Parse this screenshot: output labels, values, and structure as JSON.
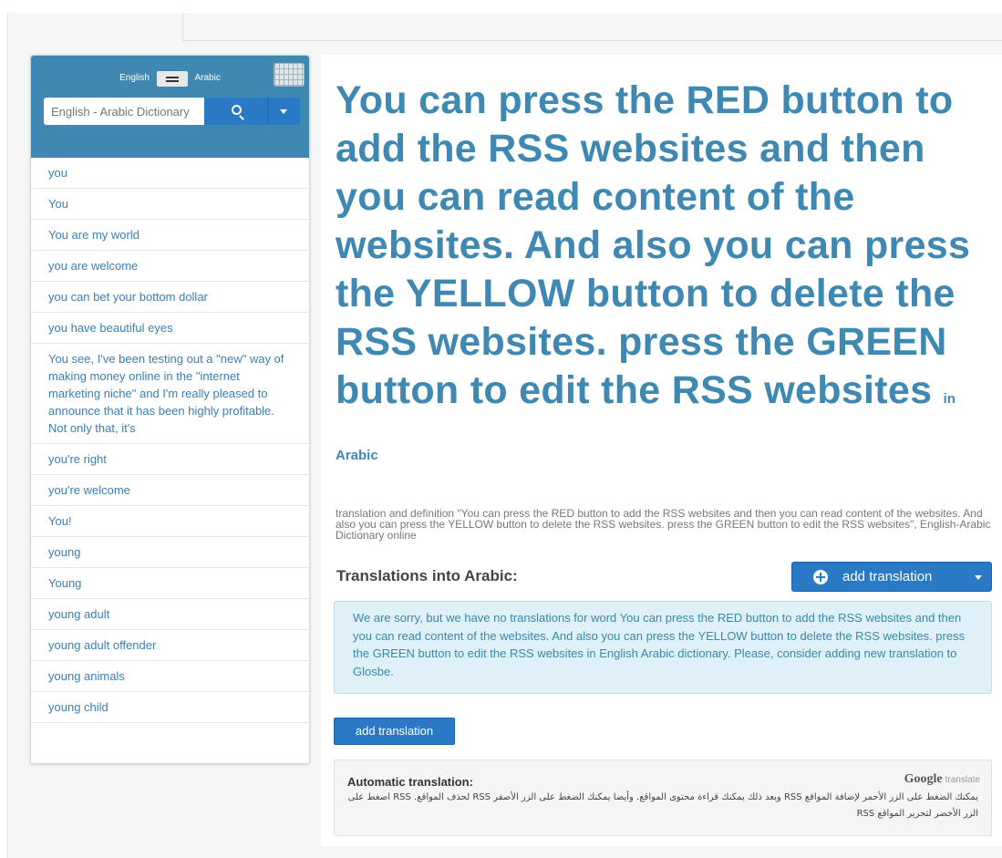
{
  "sidebar": {
    "lang_from": "English",
    "lang_to": "Arabic",
    "search_placeholder": "English - Arabic Dictionary",
    "suggestions": [
      "you",
      "You",
      "You are my world",
      "you are welcome",
      "you can bet your bottom dollar",
      "you have beautiful eyes",
      "You see, I've been testing out a \"new\" way of making money online in the \"internet marketing niche\" and I'm really pleased to announce that it has been highly profitable. Not only that, it's",
      "you're right",
      "you're welcome",
      "You!",
      "young",
      "Young",
      "young adult",
      "young adult offender",
      "young animals",
      "young child"
    ]
  },
  "main": {
    "headline": "You can press the RED button to add the RSS websites and then you can read content of the websites. And also you can press the YELLOW button to delete the RSS websites. press the GREEN button to edit the RSS websites",
    "headline_suffix": "in Arabic",
    "definition": "translation and definition \"You can press the RED button to add the RSS websites and then you can read content of the websites. And also you can press the YELLOW button to delete the RSS websites. press the GREEN button to edit the RSS websites\", English-Arabic Dictionary  online",
    "translations_heading": "Translations into Arabic:",
    "add_translation_dropdown_label": "add translation",
    "notice": "We are sorry, but we have no translations for word You can press the RED button to add the RSS websites and then you can read content of the websites. And also you can press the YELLOW button to delete the RSS websites. press the GREEN button to edit the RSS websites in English Arabic dictionary. Please, consider adding new translation to Glosbe.",
    "add_translation_button_label": "add translation",
    "automatic_title": "Automatic translation:",
    "google_brand": "Google",
    "google_translate": "translate",
    "automatic_text": "يمكنك الضغط على الزر الأحمر لإضافة المواقع RSS وبعد ذلك يمكنك قراءة محتوى المواقع. وأيضا يمكنك الضغط على الزر الأصفر RSS لحذف المواقع. RSS اضغط على الزر الأخضر لتحرير المواقع RSS"
  },
  "colors": {
    "brand_blue": "#3f88b2",
    "button_blue": "#2a79c6",
    "notice_bg": "#dff0f8"
  }
}
